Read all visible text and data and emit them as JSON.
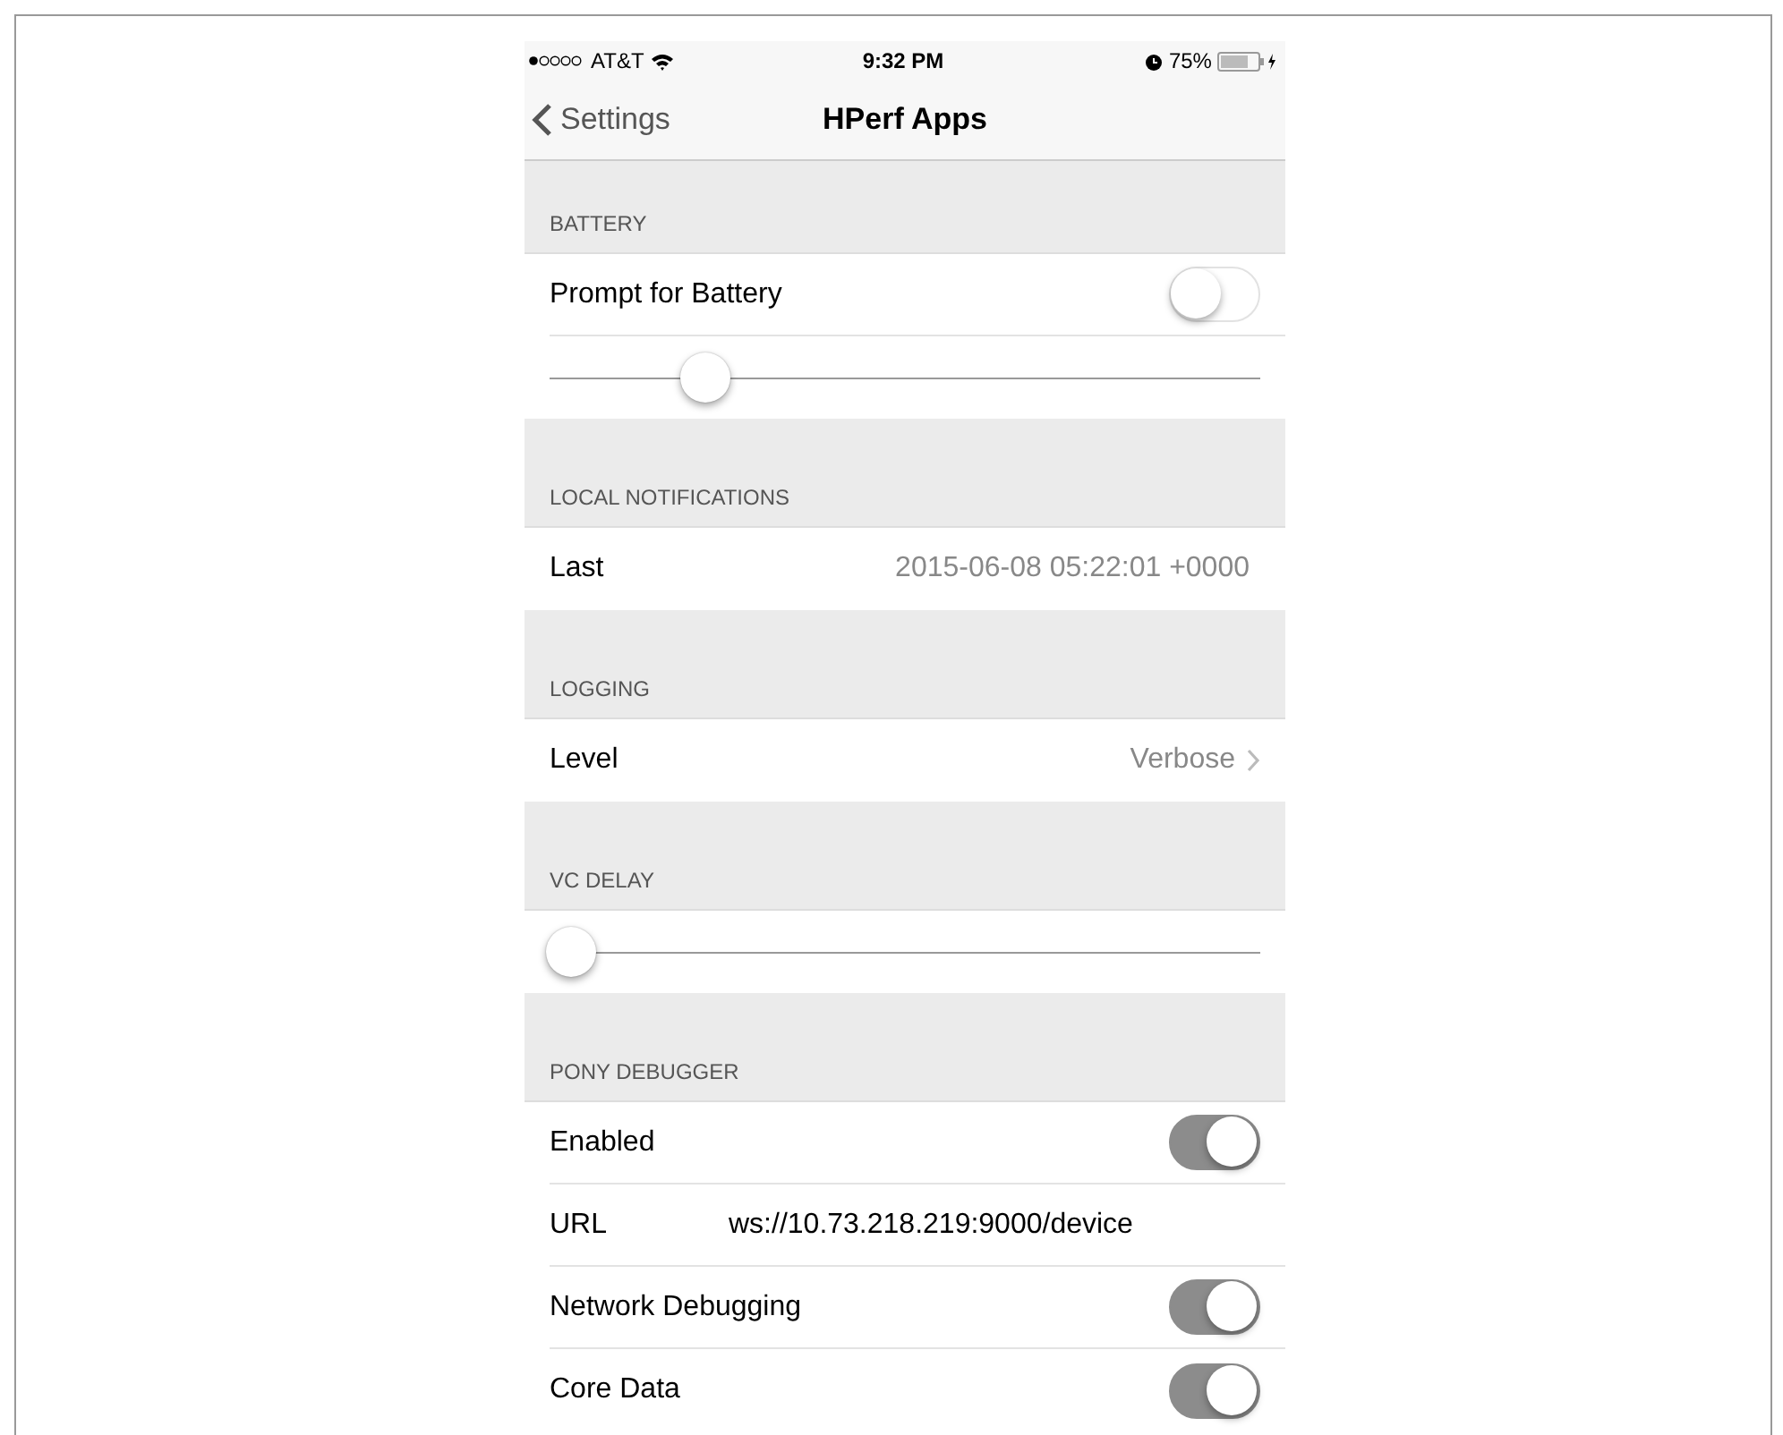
{
  "status_bar": {
    "carrier": "AT&T",
    "time": "9:32 PM",
    "battery_percent": "75%"
  },
  "nav": {
    "back": "Settings",
    "title": "HPerf Apps"
  },
  "sections": [
    {
      "header": "BATTERY",
      "rows": [
        {
          "kind": "toggle",
          "label": "Prompt for Battery",
          "on": false
        },
        {
          "kind": "slider",
          "level": 0.22
        }
      ]
    },
    {
      "header": "LOCAL NOTIFICATIONS",
      "rows": [
        {
          "kind": "value",
          "label": "Last",
          "value": "2015-06-08 05:22:01 +0000"
        }
      ]
    },
    {
      "header": "LOGGING",
      "rows": [
        {
          "kind": "disclosure",
          "label": "Level",
          "value": "Verbose"
        }
      ]
    },
    {
      "header": "VC DELAY",
      "rows": [
        {
          "kind": "slider",
          "level": 0.03
        }
      ]
    },
    {
      "header": "PONY DEBUGGER",
      "rows": [
        {
          "kind": "toggle",
          "label": "Enabled",
          "on": true
        },
        {
          "kind": "text",
          "label": "URL",
          "value": "ws://10.73.218.219:9000/device"
        },
        {
          "kind": "toggle",
          "label": "Network Debugging",
          "on": true
        },
        {
          "kind": "toggle",
          "label": "Core Data",
          "on": true
        }
      ]
    }
  ]
}
